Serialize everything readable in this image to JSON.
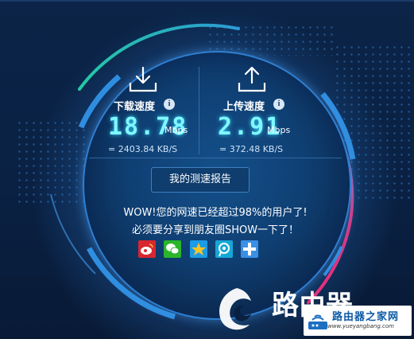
{
  "download": {
    "label": "下载速度",
    "info": "i",
    "value": "18.78",
    "unit": "Mbps",
    "kb": "= 2403.84  KB/S"
  },
  "upload": {
    "label": "上传速度",
    "info": "i",
    "value": "2.91",
    "unit": "Mbps",
    "kb": "= 372.48  KB/S"
  },
  "report_button": "我的测速报告",
  "message_line1": "WOW!您的网速已经超过98%的用户了!",
  "message_line2": "必须要分享到朋友圈SHOW一下了！",
  "share_icons": [
    "weibo-icon",
    "wechat-icon",
    "qzone-icon",
    "tencent-weibo-icon",
    "more-plus-icon"
  ],
  "watermark": {
    "brand_text": "路由器",
    "site_title": "路由器之家网",
    "site_url": "www.yueyangbang.com"
  },
  "colors": {
    "speed": "#7ff7ff",
    "background": "#0a2040",
    "ring_teal": "#20c6a8",
    "ring_blue": "#2f8ee0",
    "ring_pink": "#e6307c"
  }
}
